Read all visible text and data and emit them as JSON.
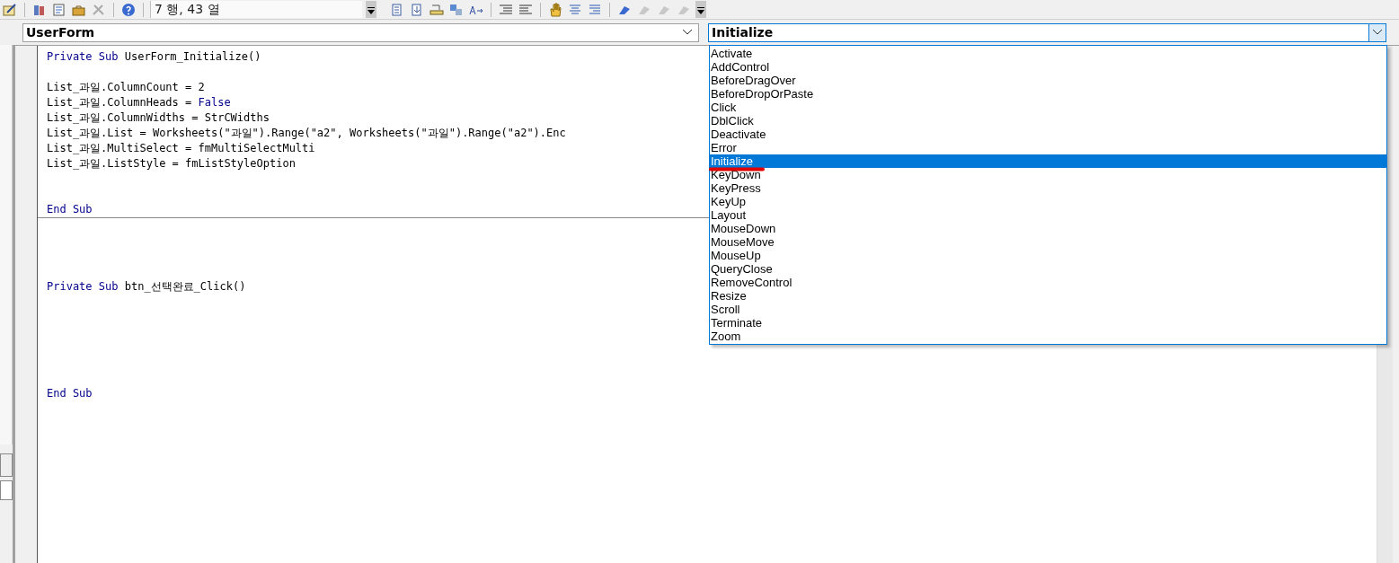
{
  "toolbar": {
    "position": "7 행, 43 열"
  },
  "object_combo": {
    "value": "UserForm"
  },
  "procedure_combo": {
    "value": "Initialize",
    "expanded": true,
    "options": [
      {
        "label": "Activate",
        "selected": false
      },
      {
        "label": "AddControl",
        "selected": false
      },
      {
        "label": "BeforeDragOver",
        "selected": false
      },
      {
        "label": "BeforeDropOrPaste",
        "selected": false
      },
      {
        "label": "Click",
        "selected": false
      },
      {
        "label": "DblClick",
        "selected": false
      },
      {
        "label": "Deactivate",
        "selected": false
      },
      {
        "label": "Error",
        "selected": false
      },
      {
        "label": "Initialize",
        "selected": true
      },
      {
        "label": "KeyDown",
        "selected": false
      },
      {
        "label": "KeyPress",
        "selected": false
      },
      {
        "label": "KeyUp",
        "selected": false
      },
      {
        "label": "Layout",
        "selected": false
      },
      {
        "label": "MouseDown",
        "selected": false
      },
      {
        "label": "MouseMove",
        "selected": false
      },
      {
        "label": "MouseUp",
        "selected": false
      },
      {
        "label": "QueryClose",
        "selected": false
      },
      {
        "label": "RemoveControl",
        "selected": false
      },
      {
        "label": "Resize",
        "selected": false
      },
      {
        "label": "Scroll",
        "selected": false
      },
      {
        "label": "Terminate",
        "selected": false
      },
      {
        "label": "Zoom",
        "selected": false
      }
    ]
  },
  "procedures": [
    {
      "lines": [
        {
          "kind": "code",
          "tokens": [
            {
              "kind": "keyword",
              "text": "Private Sub"
            },
            {
              "kind": "plain",
              "text": " UserForm_Initialize()"
            }
          ]
        },
        {
          "kind": "blank"
        },
        {
          "kind": "code",
          "tokens": [
            {
              "kind": "plain",
              "text": "List_과일.ColumnCount = 2"
            }
          ]
        },
        {
          "kind": "code",
          "tokens": [
            {
              "kind": "plain",
              "text": "List_과일.ColumnHeads = "
            },
            {
              "kind": "keyword",
              "text": "False"
            }
          ]
        },
        {
          "kind": "code",
          "tokens": [
            {
              "kind": "plain",
              "text": "List_과일.ColumnWidths = StrCWidths"
            }
          ]
        },
        {
          "kind": "code",
          "tokens": [
            {
              "kind": "plain",
              "text": "List_과일.List = Worksheets(\"과일\").Range(\"a2\", Worksheets(\"과일\").Range(\"a2\").Enc"
            }
          ]
        },
        {
          "kind": "code",
          "tokens": [
            {
              "kind": "plain",
              "text": "List_과일.MultiSelect = fmMultiSelectMulti"
            }
          ]
        },
        {
          "kind": "code",
          "tokens": [
            {
              "kind": "plain",
              "text": "List_과일.ListStyle = fmListStyleOption"
            }
          ]
        },
        {
          "kind": "blank"
        },
        {
          "kind": "blank"
        },
        {
          "kind": "code",
          "tokens": [
            {
              "kind": "keyword",
              "text": "End Sub"
            }
          ]
        }
      ]
    },
    {
      "lines": [
        {
          "kind": "blank"
        },
        {
          "kind": "blank"
        },
        {
          "kind": "blank"
        },
        {
          "kind": "blank"
        },
        {
          "kind": "code",
          "tokens": [
            {
              "kind": "keyword",
              "text": "Private Sub"
            },
            {
              "kind": "plain",
              "text": " btn_선택완료_Click()"
            }
          ]
        },
        {
          "kind": "blank"
        },
        {
          "kind": "blank"
        },
        {
          "kind": "blank"
        },
        {
          "kind": "blank"
        },
        {
          "kind": "blank"
        },
        {
          "kind": "blank"
        },
        {
          "kind": "code",
          "tokens": [
            {
              "kind": "keyword",
              "text": "End Sub"
            }
          ]
        }
      ]
    }
  ]
}
